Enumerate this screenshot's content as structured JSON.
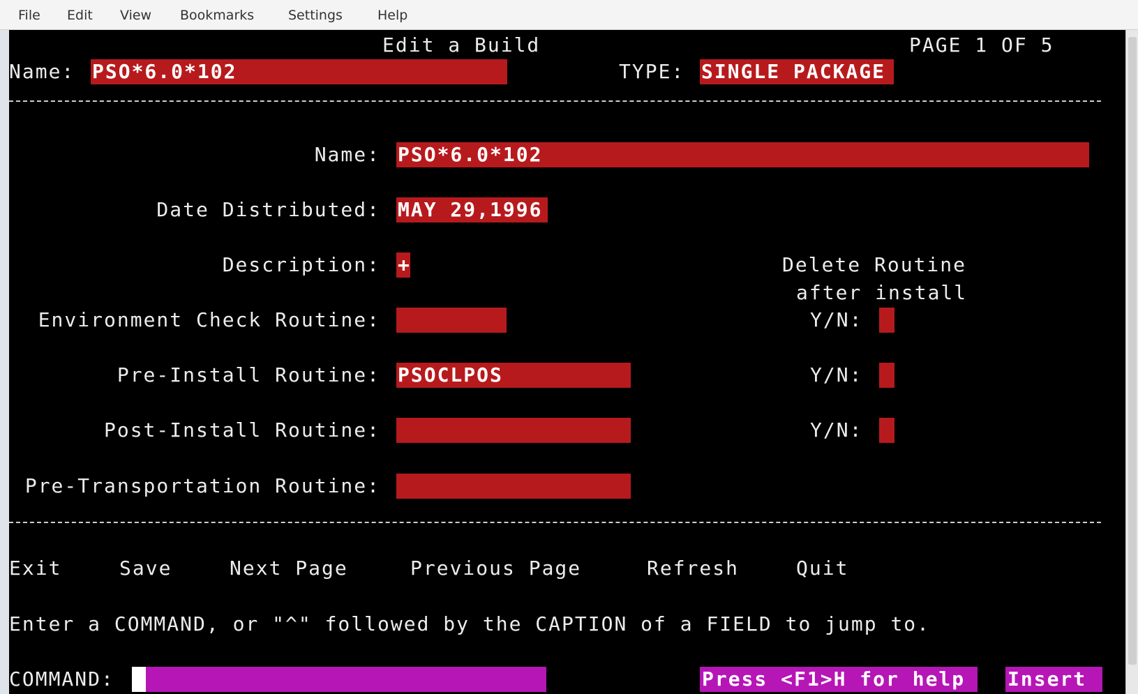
{
  "menu": [
    "File",
    "Edit",
    "View",
    "Bookmarks",
    "Settings",
    "Help"
  ],
  "header": {
    "title": "Edit a Build",
    "page": "PAGE 1 OF 5",
    "name_label": "Name:",
    "name_value": "PSO*6.0*102",
    "type_label": "TYPE:",
    "type_value": "SINGLE PACKAGE"
  },
  "form": {
    "name_label": "Name:",
    "name_value": "PSO*6.0*102",
    "date_label": "Date Distributed:",
    "date_value": "MAY 29,1996",
    "desc_label": "Description:",
    "desc_value": "+",
    "delete_header_1": "Delete Routine",
    "delete_header_2": "after install",
    "env_label": "Environment Check Routine:",
    "env_value": "",
    "env_yn_label": "Y/N:",
    "env_yn": "",
    "pre_label": "Pre-Install Routine:",
    "pre_value": "PSOCLPOS",
    "pre_yn_label": "Y/N:",
    "pre_yn": "",
    "post_label": "Post-Install Routine:",
    "post_value": "",
    "post_yn_label": "Y/N:",
    "post_yn": "",
    "trans_label": "Pre-Transportation Routine:",
    "trans_value": ""
  },
  "commands": [
    "Exit",
    "Save",
    "Next Page",
    "Previous Page",
    "Refresh",
    "Quit"
  ],
  "hint": "Enter a COMMAND, or \"^\" followed by the CAPTION of a FIELD to jump to.",
  "command_bar": {
    "label": "COMMAND:",
    "value": "",
    "help": "Press <F1>H for help",
    "mode": "Insert"
  },
  "colors": {
    "field": "#b71a1d",
    "status": "#b616b6",
    "background": "#000000",
    "text": "#ececec"
  }
}
